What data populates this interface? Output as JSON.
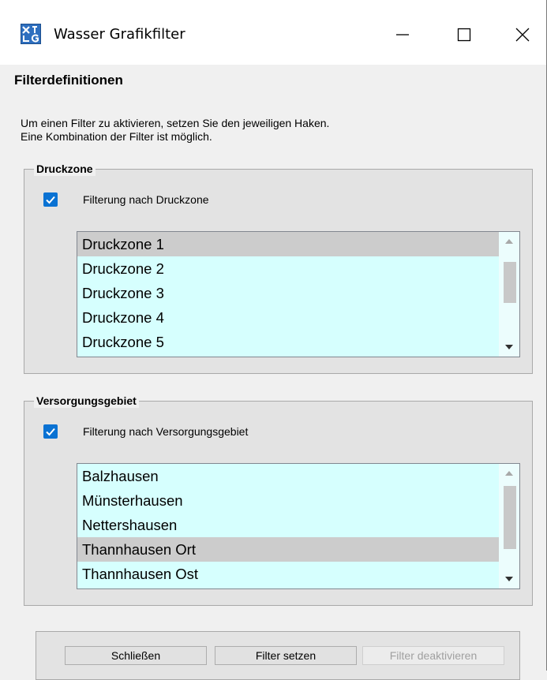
{
  "window": {
    "title": "Wasser Grafikfilter",
    "controls": [
      "minimize",
      "maximize",
      "close"
    ]
  },
  "heading": "Filterdefinitionen",
  "instructions": [
    "Um einen Filter zu aktivieren, setzen Sie den jeweiligen Haken.",
    "Eine Kombination der Filter ist möglich."
  ],
  "druckzone": {
    "legend": "Druckzone",
    "checkbox_label": "Filterung nach Druckzone",
    "checked": true,
    "items": [
      "Druckzone 1",
      "Druckzone 2",
      "Druckzone 3",
      "Druckzone 4",
      "Druckzone 5"
    ],
    "selected": "Druckzone 1"
  },
  "versorgungsgebiet": {
    "legend": "Versorgungsgebiet",
    "checkbox_label": "Filterung nach Versorgungsgebiet",
    "checked": true,
    "items": [
      "Balzhausen",
      "Münsterhausen",
      "Nettershausen",
      "Thannhausen Ort",
      "Thannhausen Ost"
    ],
    "selected": "Thannhausen Ort"
  },
  "buttons": {
    "close": "Schließen",
    "apply": "Filter setzen",
    "deactivate": "Filter deaktivieren",
    "deactivate_enabled": false
  },
  "colors": {
    "list_background": "#d6fffe",
    "selection": "#cccccc",
    "checkbox": "#0a72d3"
  }
}
